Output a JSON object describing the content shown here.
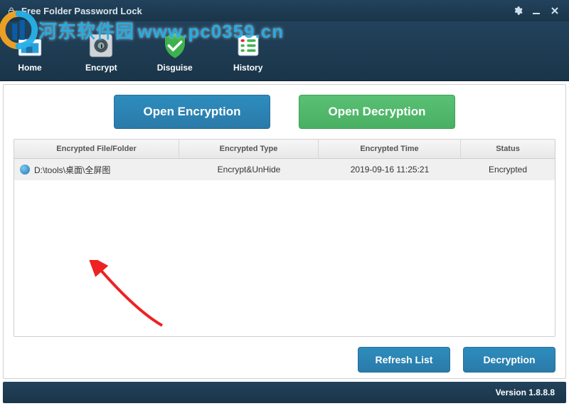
{
  "window": {
    "title": "Free Folder Password Lock"
  },
  "toolbar": {
    "items": [
      {
        "label": "Home"
      },
      {
        "label": "Encrypt"
      },
      {
        "label": "Disguise"
      },
      {
        "label": "History"
      }
    ]
  },
  "actions": {
    "open_encryption": "Open Encryption",
    "open_decryption": "Open Decryption",
    "refresh": "Refresh List",
    "decrypt": "Decryption"
  },
  "grid": {
    "headers": {
      "path": "Encrypted File/Folder",
      "type": "Encrypted Type",
      "time": "Encrypted Time",
      "status": "Status"
    },
    "rows": [
      {
        "path": "D:\\tools\\桌面\\全屏图",
        "type": "Encrypt&UnHide",
        "time": "2019-09-16 11:25:21",
        "status": "Encrypted"
      }
    ]
  },
  "status": {
    "version_label": "Version",
    "version": "1.8.8.8"
  },
  "watermark": {
    "brand": "河东软件园",
    "domain": "www.pc0359.cn"
  }
}
